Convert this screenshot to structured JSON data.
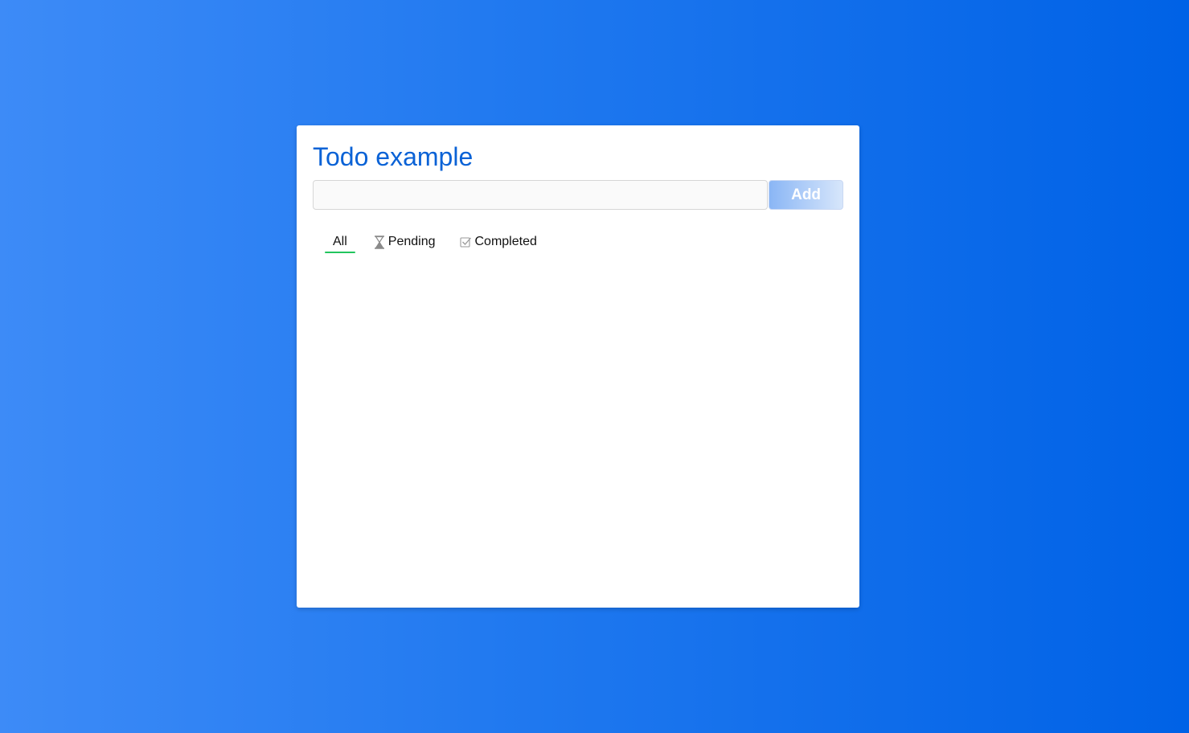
{
  "app": {
    "title": "Todo example"
  },
  "input": {
    "value": "",
    "placeholder": ""
  },
  "add_button": {
    "label": "Add"
  },
  "tabs": [
    {
      "label": "All",
      "icon": null,
      "active": true
    },
    {
      "label": "Pending",
      "icon": "hourglass-icon",
      "active": false
    },
    {
      "label": "Completed",
      "icon": "checkbox-checked-icon",
      "active": false
    }
  ],
  "colors": {
    "title": "#0a62d6",
    "active_tab_underline": "#22c55e",
    "background_start": "#3d8bf7",
    "background_end": "#0062e6"
  },
  "todos": []
}
